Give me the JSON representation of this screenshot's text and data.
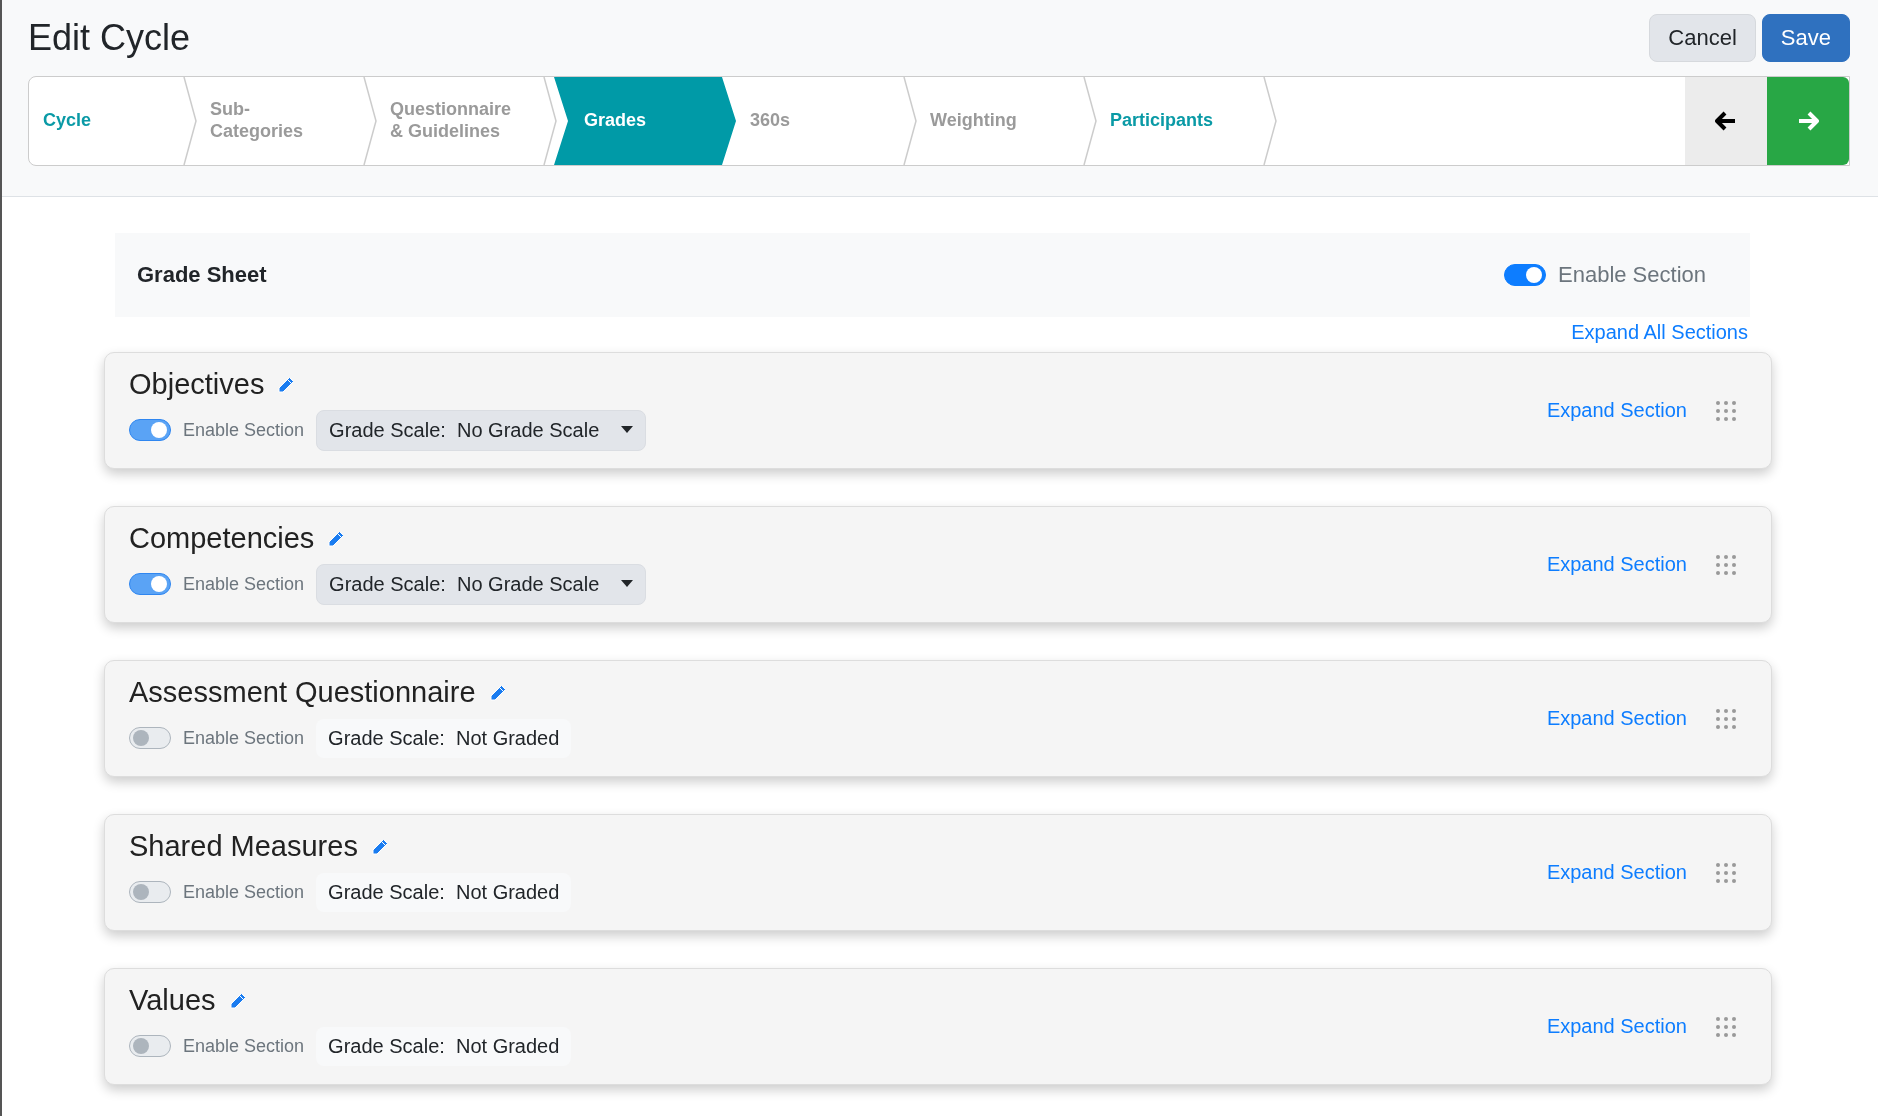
{
  "header": {
    "title": "Edit Cycle",
    "buttons": [
      {
        "label": "Cancel",
        "kind": "secondary"
      },
      {
        "label": "Save",
        "kind": "primary"
      }
    ]
  },
  "steps": [
    {
      "label": "Cycle",
      "selected": false,
      "done": true
    },
    {
      "label": "Sub-\nCategories",
      "selected": false,
      "done": false
    },
    {
      "label": "Questionnaire\n& Guidelines",
      "selected": false,
      "done": false
    },
    {
      "label": "Grades",
      "selected": true,
      "done": false
    },
    {
      "label": "360s",
      "selected": false,
      "done": false
    },
    {
      "label": "Weighting",
      "selected": false,
      "done": false
    },
    {
      "label": "Participants",
      "selected": false,
      "done": true
    }
  ],
  "grade_sheet": {
    "title": "Grade Sheet",
    "enabled": true,
    "toggle_label": "Enable Section"
  },
  "expand_all": "Expand All Sections",
  "sections": [
    {
      "title": "Objectives",
      "enabled": true,
      "toggle_label": "Enable Section",
      "scale_label": "Grade Scale:",
      "scale": "No Grade Scale",
      "kind": "dropdown",
      "expand": "Expand Section"
    },
    {
      "title": "Competencies",
      "enabled": true,
      "toggle_label": "Enable Section",
      "scale_label": "Grade Scale:",
      "scale": "No Grade Scale",
      "kind": "dropdown",
      "expand": "Expand Section"
    },
    {
      "title": "Assessment Questionnaire",
      "enabled": false,
      "toggle_label": "Enable Section",
      "scale_label": "Grade Scale:",
      "scale": "Not Graded",
      "kind": "fixed",
      "expand": "Expand Section"
    },
    {
      "title": "Shared Measures",
      "enabled": false,
      "toggle_label": "Enable Section",
      "scale_label": "Grade Scale:",
      "scale": "Not Graded",
      "kind": "fixed",
      "expand": "Expand Section"
    },
    {
      "title": "Values",
      "enabled": false,
      "toggle_label": "Enable Section",
      "scale_label": "Grade Scale:",
      "scale": "Not Graded",
      "kind": "fixed",
      "expand": "Expand Section"
    }
  ]
}
